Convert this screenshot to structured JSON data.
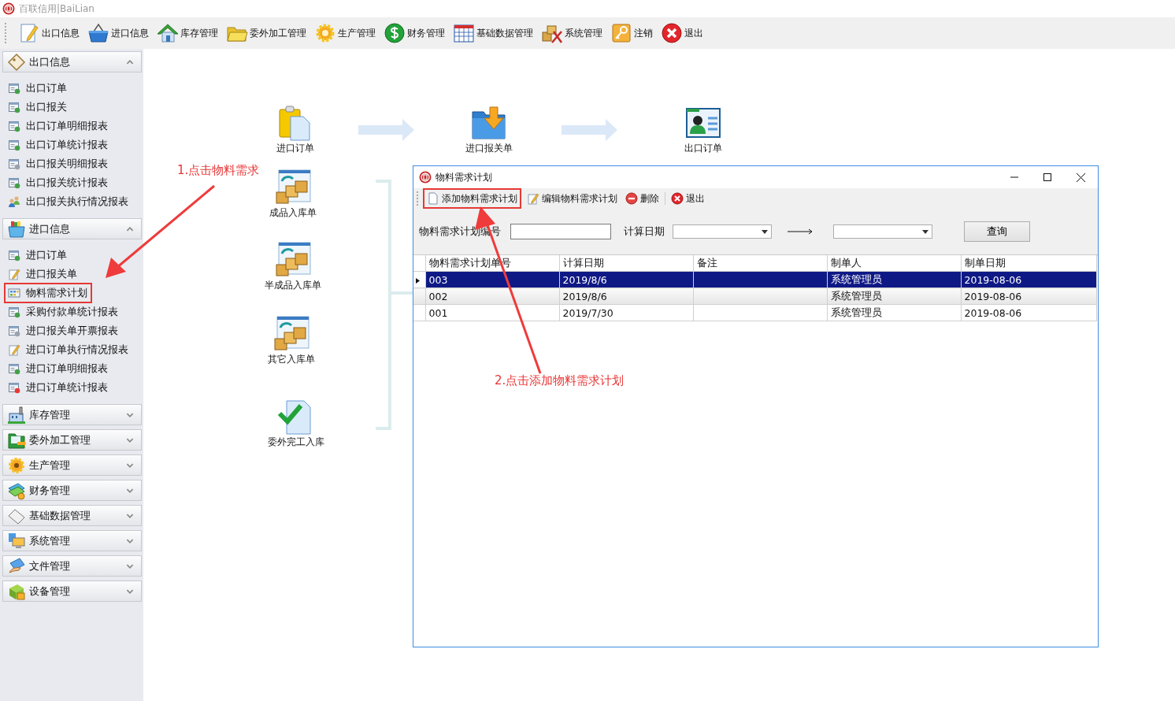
{
  "app": {
    "title": "百联信用|BaiLian"
  },
  "toolbar": [
    {
      "label": "出口信息"
    },
    {
      "label": "进口信息"
    },
    {
      "label": "库存管理"
    },
    {
      "label": "委外加工管理"
    },
    {
      "label": "生产管理"
    },
    {
      "label": "财务管理"
    },
    {
      "label": "基础数据管理"
    },
    {
      "label": "系统管理"
    },
    {
      "label": "注销"
    },
    {
      "label": "退出"
    }
  ],
  "sidebar": {
    "groups": [
      {
        "label": "出口信息",
        "expanded": true,
        "items": [
          {
            "label": "出口订单",
            "highlighted": false
          },
          {
            "label": "出口报关",
            "highlighted": false
          },
          {
            "label": "出口订单明细报表",
            "highlighted": false
          },
          {
            "label": "出口订单统计报表",
            "highlighted": false
          },
          {
            "label": "出口报关明细报表",
            "highlighted": false
          },
          {
            "label": "出口报关统计报表",
            "highlighted": false
          },
          {
            "label": "出口报关执行情况报表",
            "highlighted": false
          }
        ]
      },
      {
        "label": "进口信息",
        "expanded": true,
        "items": [
          {
            "label": "进口订单",
            "highlighted": false
          },
          {
            "label": "进口报关单",
            "highlighted": false
          },
          {
            "label": "物料需求计划",
            "highlighted": true
          },
          {
            "label": "采购付款单统计报表",
            "highlighted": false
          },
          {
            "label": "进口报关单开票报表",
            "highlighted": false
          },
          {
            "label": "进口订单执行情况报表",
            "highlighted": false
          },
          {
            "label": "进口订单明细报表",
            "highlighted": false
          },
          {
            "label": "进口订单统计报表",
            "highlighted": false
          }
        ]
      },
      {
        "label": "库存管理",
        "expanded": false
      },
      {
        "label": "委外加工管理",
        "expanded": false
      },
      {
        "label": "生产管理",
        "expanded": false
      },
      {
        "label": "财务管理",
        "expanded": false
      },
      {
        "label": "基础数据管理",
        "expanded": false
      },
      {
        "label": "系统管理",
        "expanded": false
      },
      {
        "label": "文件管理",
        "expanded": false
      },
      {
        "label": "设备管理",
        "expanded": false
      }
    ]
  },
  "flow": {
    "nodes": [
      {
        "label": "进口订单"
      },
      {
        "label": "进口报关单"
      },
      {
        "label": "出口订单"
      },
      {
        "label": "成品入库单"
      },
      {
        "label": "半成品入库单"
      },
      {
        "label": "其它入库单"
      },
      {
        "label": "委外完工入库"
      }
    ]
  },
  "dialog": {
    "title": "物料需求计划",
    "toolbar": [
      {
        "label": "添加物料需求计划",
        "highlighted": true
      },
      {
        "label": "编辑物料需求计划",
        "highlighted": false
      },
      {
        "label": "删除",
        "highlighted": false
      },
      {
        "label": "退出",
        "highlighted": false
      }
    ],
    "filters": {
      "code_label": "物料需求计划编号",
      "date_label": "计算日期",
      "query_button": "查询"
    },
    "table": {
      "columns": [
        "物料需求计划单号",
        "计算日期",
        "备注",
        "制单人",
        "制单日期"
      ],
      "rows": [
        {
          "cells": [
            "003",
            "2019/8/6",
            "",
            "系统管理员",
            "2019-08-06"
          ],
          "selected": true
        },
        {
          "cells": [
            "002",
            "2019/8/6",
            "",
            "系统管理员",
            "2019-08-06"
          ],
          "selected": false
        },
        {
          "cells": [
            "001",
            "2019/7/30",
            "",
            "系统管理员",
            "2019-08-06"
          ],
          "selected": false
        }
      ]
    }
  },
  "annotations": [
    {
      "text": "1.点击物料需求"
    },
    {
      "text": "2.点击添加物料需求计划"
    }
  ]
}
